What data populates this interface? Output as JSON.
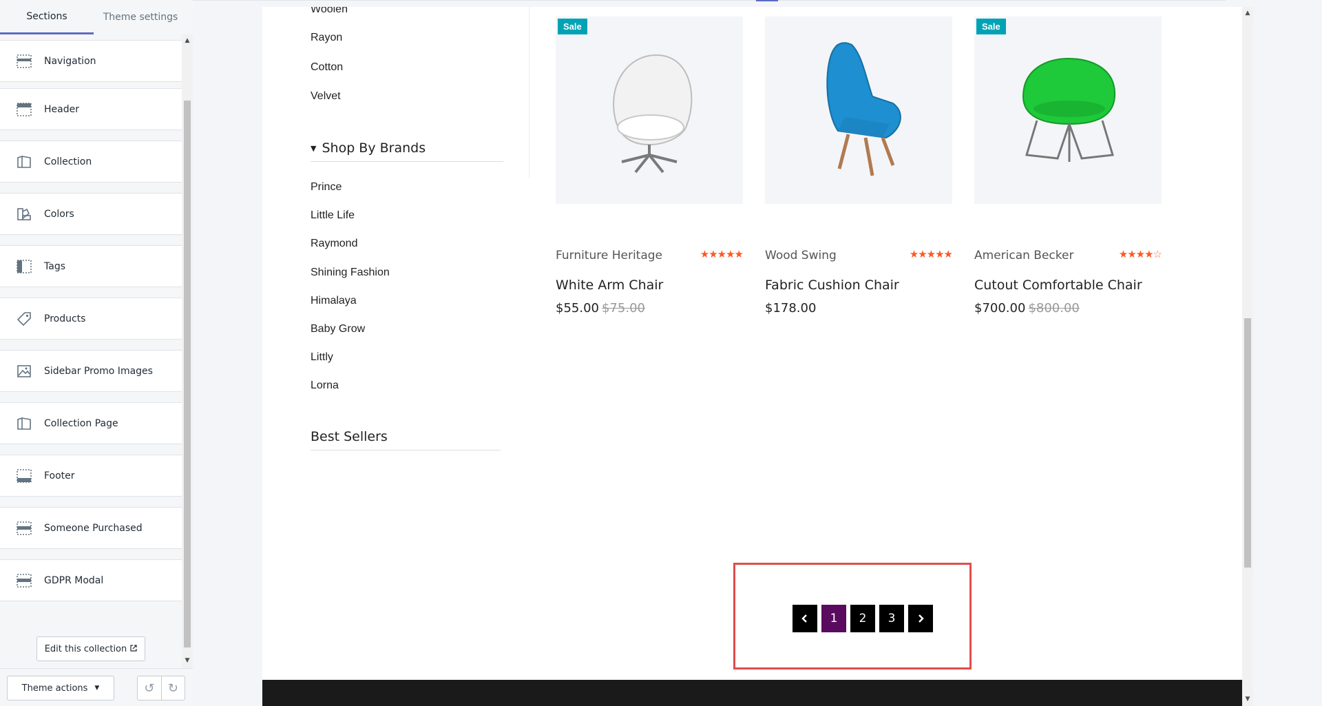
{
  "editor": {
    "tabs": [
      {
        "label": "Sections",
        "active": true
      },
      {
        "label": "Theme settings",
        "active": false
      }
    ],
    "sections": [
      {
        "label": "Navigation",
        "icon": "navigation-section-icon"
      },
      {
        "label": "Header",
        "icon": "header-section-icon"
      },
      {
        "label": "Collection",
        "icon": "collection-section-icon"
      },
      {
        "label": "Colors",
        "icon": "colors-section-icon"
      },
      {
        "label": "Tags",
        "icon": "tags-section-icon"
      },
      {
        "label": "Products",
        "icon": "products-tag-icon"
      },
      {
        "label": "Sidebar Promo Images",
        "icon": "image-icon"
      },
      {
        "label": "Collection Page",
        "icon": "collection-page-icon"
      },
      {
        "label": "Footer",
        "icon": "footer-section-icon"
      },
      {
        "label": "Someone Purchased",
        "icon": "someone-purchased-section-icon"
      },
      {
        "label": "GDPR Modal",
        "icon": "gdpr-modal-section-icon"
      }
    ],
    "edit_collection_label": "Edit this collection",
    "theme_actions_label": "Theme actions"
  },
  "preview": {
    "materials": [
      "Woolen",
      "Rayon",
      "Cotton",
      "Velvet"
    ],
    "brands_heading": "Shop By Brands",
    "brands": [
      "Prince",
      "Little Life",
      "Raymond",
      "Shining Fashion",
      "Himalaya",
      "Baby Grow",
      "Littly",
      "Lorna"
    ],
    "best_sellers_heading": "Best Sellers",
    "products": [
      {
        "vendor": "Furniture Heritage",
        "title": "White Arm Chair",
        "price": "$55.00",
        "old_price": "$75.00",
        "sale": "Sale",
        "rating": 5
      },
      {
        "vendor": "Wood Swing",
        "title": "Fabric Cushion Chair",
        "price": "$178.00",
        "old_price": "",
        "sale": "",
        "rating": 5
      },
      {
        "vendor": "American Becker",
        "title": "Cutout Comfortable Chair",
        "price": "$700.00",
        "old_price": "$800.00",
        "sale": "Sale",
        "rating": 4
      }
    ],
    "pagination": {
      "pages": [
        "1",
        "2",
        "3"
      ],
      "current": "1"
    }
  },
  "colors": {
    "accent": "#5c6ac4",
    "sale_badge": "#00a3b5",
    "star": "#ff5722",
    "active_page": "#5a0a5f",
    "highlight": "#e04c4c"
  }
}
